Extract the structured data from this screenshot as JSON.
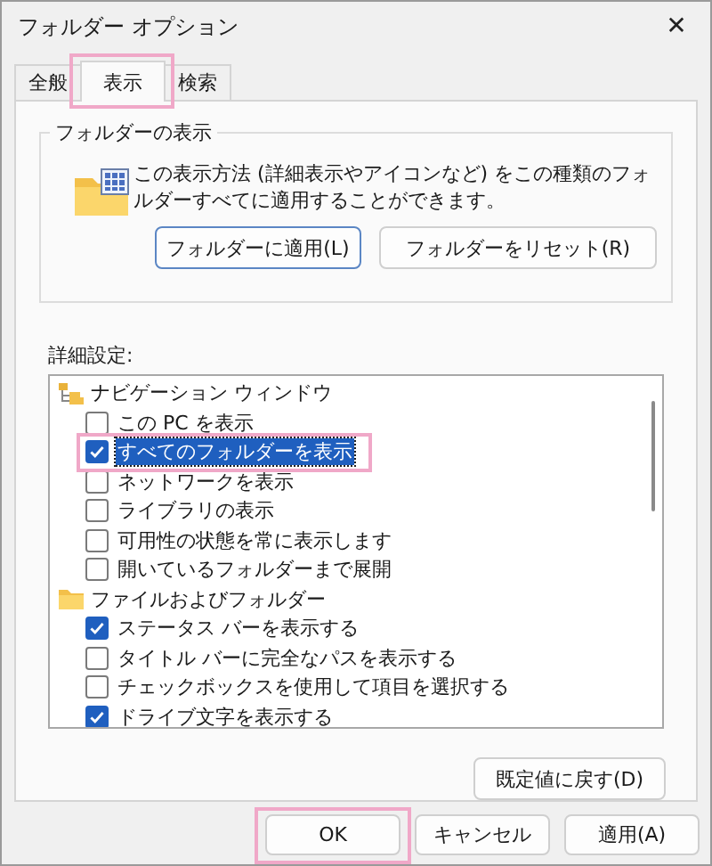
{
  "window": {
    "title": "フォルダー オプション",
    "close": "✕"
  },
  "tabs": [
    {
      "label": "全般",
      "selected": false,
      "highlighted": false
    },
    {
      "label": "表示",
      "selected": true,
      "highlighted": true
    },
    {
      "label": "検索",
      "selected": false,
      "highlighted": false
    }
  ],
  "folder_view": {
    "title": "フォルダーの表示",
    "description": "この表示方法 (詳細表示やアイコンなど) をこの種類のフォルダーすべてに適用することができます。",
    "buttons": [
      {
        "label": "フォルダーに適用(L)",
        "focused": true
      },
      {
        "label": "フォルダーをリセット(R)",
        "focused": false
      }
    ]
  },
  "advanced": {
    "label": "詳細設定:",
    "items": [
      {
        "kind": "tree-group",
        "label": "ナビゲーション ウィンドウ",
        "children": [
          {
            "kind": "checkbox",
            "label": "この PC を表示",
            "checked": false,
            "selected": false,
            "highlighted": false
          },
          {
            "kind": "checkbox",
            "label": "すべてのフォルダーを表示",
            "checked": true,
            "selected": true,
            "highlighted": true
          },
          {
            "kind": "checkbox",
            "label": "ネットワークを表示",
            "checked": false,
            "selected": false,
            "highlighted": false
          },
          {
            "kind": "checkbox",
            "label": "ライブラリの表示",
            "checked": false,
            "selected": false,
            "highlighted": false
          },
          {
            "kind": "checkbox",
            "label": "可用性の状態を常に表示します",
            "checked": false,
            "selected": false,
            "highlighted": false
          },
          {
            "kind": "checkbox",
            "label": "開いているフォルダーまで展開",
            "checked": false,
            "selected": false,
            "highlighted": false
          }
        ]
      },
      {
        "kind": "folder-group",
        "label": "ファイルおよびフォルダー",
        "children": [
          {
            "kind": "checkbox",
            "label": "ステータス バーを表示する",
            "checked": true,
            "selected": false,
            "highlighted": false
          },
          {
            "kind": "checkbox",
            "label": "タイトル バーに完全なパスを表示する",
            "checked": false,
            "selected": false,
            "highlighted": false
          },
          {
            "kind": "checkbox",
            "label": "チェックボックスを使用して項目を選択する",
            "checked": false,
            "selected": false,
            "highlighted": false
          },
          {
            "kind": "checkbox",
            "label": "ドライブ文字を表示する",
            "checked": true,
            "selected": false,
            "highlighted": false
          }
        ]
      }
    ],
    "restore_button": "既定値に戻す(D)"
  },
  "buttons": [
    {
      "label": "OK",
      "highlighted": true
    },
    {
      "label": "キャンセル",
      "highlighted": false
    },
    {
      "label": "適用(A)",
      "highlighted": false
    }
  ]
}
